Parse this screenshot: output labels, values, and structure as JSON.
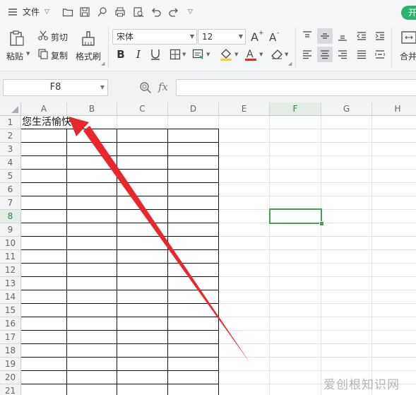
{
  "menubar": {
    "file_label": "文件",
    "start_tab": "开"
  },
  "ribbon": {
    "paste_label": "粘贴",
    "cut_label": "剪切",
    "copy_label": "复制",
    "format_painter_label": "格式刷",
    "font_name": "宋体",
    "font_size": "12",
    "merge_label": "合并"
  },
  "formula_bar": {
    "cell_ref": "F8",
    "fx_label": "fx"
  },
  "sheet": {
    "columns": [
      "A",
      "B",
      "C",
      "D",
      "E",
      "F",
      "G",
      "H"
    ],
    "rows": [
      "1",
      "2",
      "3",
      "4",
      "5",
      "6",
      "7",
      "8",
      "9",
      "10",
      "11",
      "12",
      "13",
      "14",
      "15",
      "16",
      "17",
      "18",
      "19",
      "20",
      "21"
    ],
    "active_column": "F",
    "active_row": "8",
    "cell_a1": "您生活愉快",
    "annotation_color": "#e8262b",
    "selection_color": "#4a9e4f"
  },
  "watermark": "爱创根知识网"
}
